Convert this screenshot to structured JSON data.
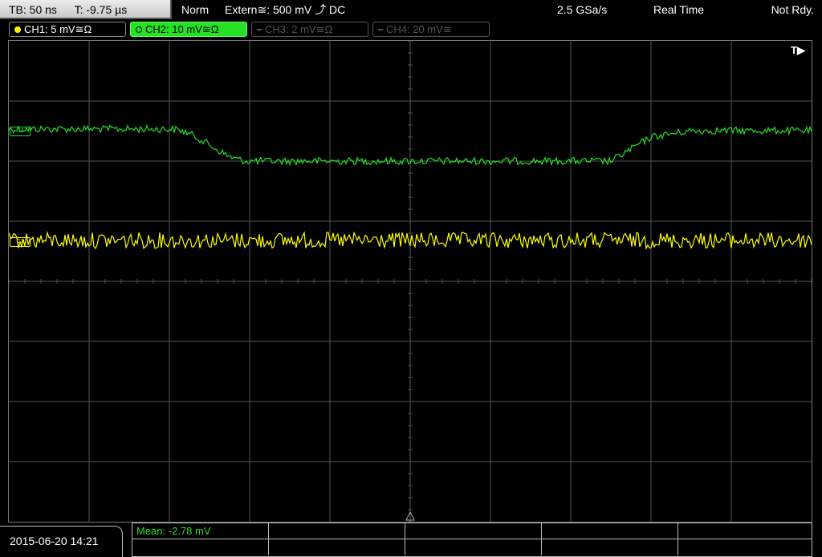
{
  "timebase": {
    "tb": "TB: 50 ns",
    "trigger_time": "T: -9.75 µs"
  },
  "status": {
    "mode": "Norm",
    "trigger_source": "Extern≅: 500 mV ⤴ DC",
    "sample_rate": "2.5 GSa/s",
    "acq_mode": "Real Time",
    "ready_state": "Not Rdy."
  },
  "channels": [
    {
      "label": "CH1: 5 mV≅Ω",
      "color": "#ffff00",
      "active": true
    },
    {
      "label": "CH2: 10 mV≅Ω",
      "color": "#25e025",
      "active": true
    },
    {
      "label": "CH3: 2 mV≅Ω",
      "color": "#555555",
      "active": false
    },
    {
      "label": "CH4: 20 mV≅",
      "color": "#555555",
      "active": false
    }
  ],
  "screen": {
    "trigger_marker": "T▶",
    "ch2_marker": "C2",
    "ch1_marker": "C1"
  },
  "footer": {
    "datetime": "2015-06-20 14:21",
    "measurement": "Mean: -2.78 mV"
  },
  "colors": {
    "ch1": "#ffff00",
    "ch2": "#25e025",
    "grid": "#555555"
  }
}
